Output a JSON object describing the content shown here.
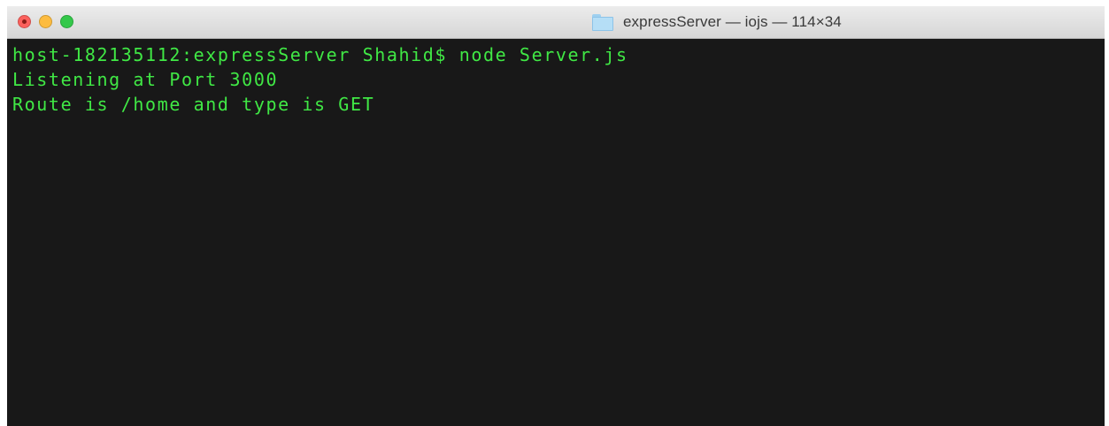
{
  "window": {
    "title": "expressServer — iojs — 114×34",
    "title_icon": "folder-icon",
    "controls": [
      "close-button",
      "minimize-button",
      "zoom-button"
    ]
  },
  "terminal": {
    "text_color": "#40e845",
    "background_color": "#181818",
    "lines": [
      "host-182135112:expressServer Shahid$ node Server.js",
      "Listening at Port 3000",
      "Route is /home and type is GET"
    ]
  },
  "colors": {
    "close": "#fc615d",
    "minimize": "#fdbc40",
    "zoom": "#34c84a"
  }
}
